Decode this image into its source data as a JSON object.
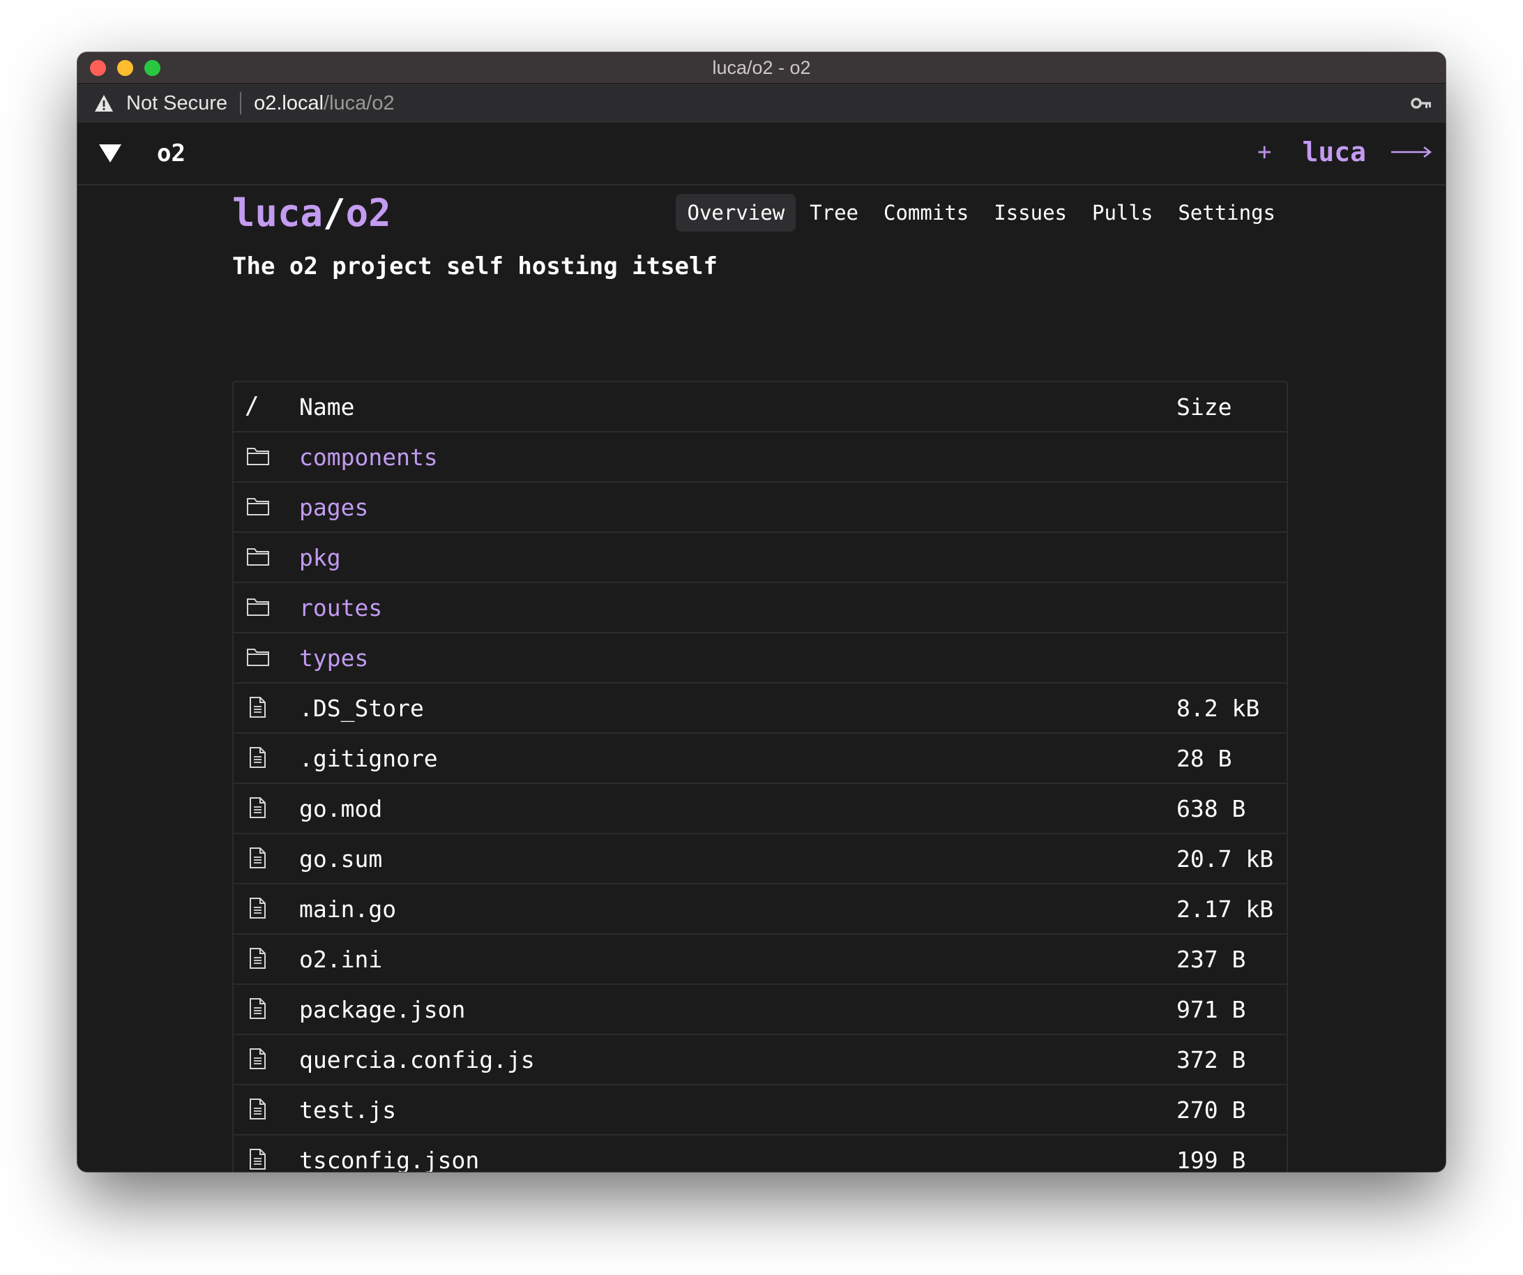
{
  "window": {
    "title": "luca/o2 - o2"
  },
  "address_bar": {
    "security_label": "Not Secure",
    "url_host": "o2.local",
    "url_path": "/luca/o2"
  },
  "navbar": {
    "brand": "o2",
    "new_label": "+",
    "username": "luca"
  },
  "repo": {
    "owner": "luca",
    "separator": "/",
    "name": "o2",
    "description": "The o2 project self hosting itself",
    "tabs": [
      {
        "label": "Overview",
        "active": true
      },
      {
        "label": "Tree"
      },
      {
        "label": "Commits"
      },
      {
        "label": "Issues"
      },
      {
        "label": "Pulls"
      },
      {
        "label": "Settings"
      }
    ]
  },
  "file_table": {
    "header": {
      "path": "/",
      "name": "Name",
      "size": "Size"
    },
    "entries": [
      {
        "type": "dir",
        "name": "components",
        "size": ""
      },
      {
        "type": "dir",
        "name": "pages",
        "size": ""
      },
      {
        "type": "dir",
        "name": "pkg",
        "size": ""
      },
      {
        "type": "dir",
        "name": "routes",
        "size": ""
      },
      {
        "type": "dir",
        "name": "types",
        "size": ""
      },
      {
        "type": "file",
        "name": ".DS_Store",
        "size": "8.2 kB"
      },
      {
        "type": "file",
        "name": ".gitignore",
        "size": "28 B"
      },
      {
        "type": "file",
        "name": "go.mod",
        "size": "638 B"
      },
      {
        "type": "file",
        "name": "go.sum",
        "size": "20.7 kB"
      },
      {
        "type": "file",
        "name": "main.go",
        "size": "2.17 kB"
      },
      {
        "type": "file",
        "name": "o2.ini",
        "size": "237 B"
      },
      {
        "type": "file",
        "name": "package.json",
        "size": "971 B"
      },
      {
        "type": "file",
        "name": "quercia.config.js",
        "size": "372 B"
      },
      {
        "type": "file",
        "name": "test.js",
        "size": "270 B"
      },
      {
        "type": "file",
        "name": "tsconfig.json",
        "size": "199 B"
      }
    ]
  },
  "colors": {
    "accent": "#c39bf1",
    "background": "#1b1b1c",
    "border": "#2b2b2d"
  }
}
